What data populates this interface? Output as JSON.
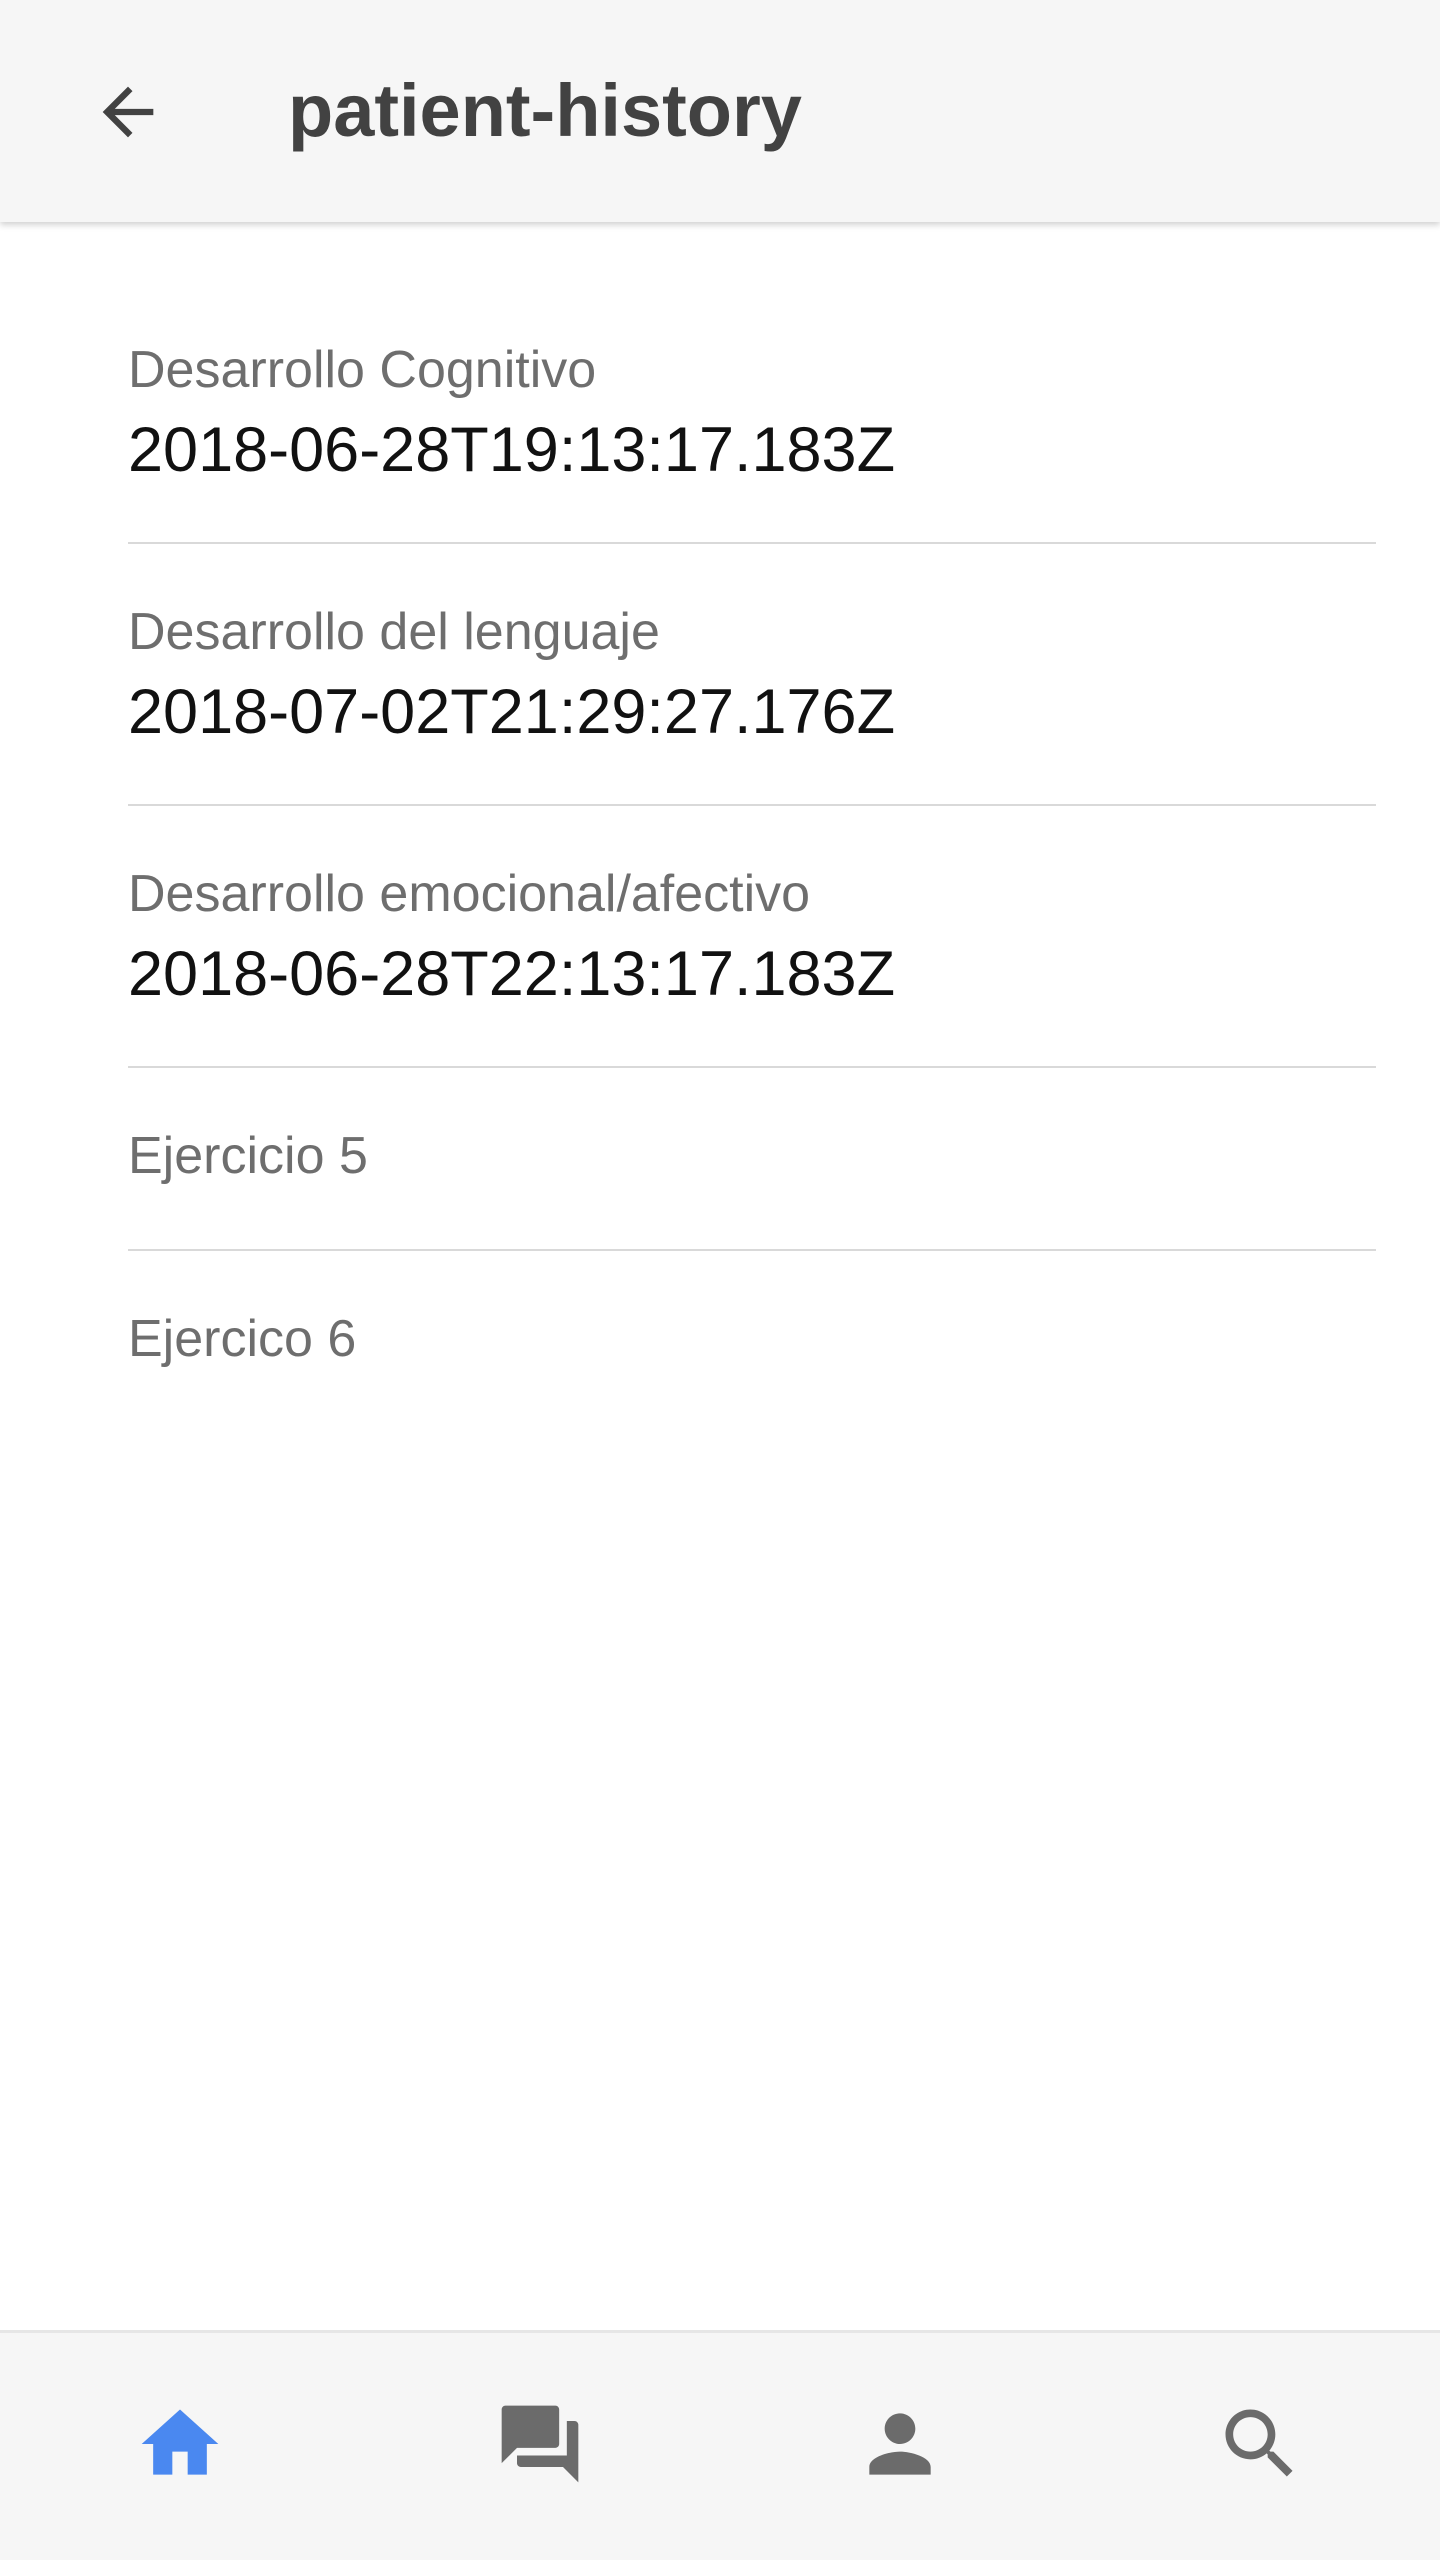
{
  "header": {
    "title": "patient-history",
    "back_icon": "arrow-back-icon"
  },
  "history": {
    "items": [
      {
        "label": "Desarrollo Cognitivo",
        "date": "2018-06-28T19:13:17.183Z"
      },
      {
        "label": "Desarrollo del lenguaje",
        "date": "2018-07-02T21:29:27.176Z"
      },
      {
        "label": "Desarrollo emocional/afectivo",
        "date": "2018-06-28T22:13:17.183Z"
      },
      {
        "label": "Ejercicio 5"
      },
      {
        "label": "Ejercico 6"
      }
    ]
  },
  "bottom_nav": {
    "tabs": [
      {
        "icon": "home-icon",
        "active": true
      },
      {
        "icon": "chat-icon",
        "active": false
      },
      {
        "icon": "person-icon",
        "active": false
      },
      {
        "icon": "search-icon",
        "active": false
      }
    ]
  },
  "colors": {
    "accent": "#4a88f0",
    "icon_inactive": "#6b6b6b",
    "header_bg": "#f6f6f6",
    "title": "#424242"
  }
}
